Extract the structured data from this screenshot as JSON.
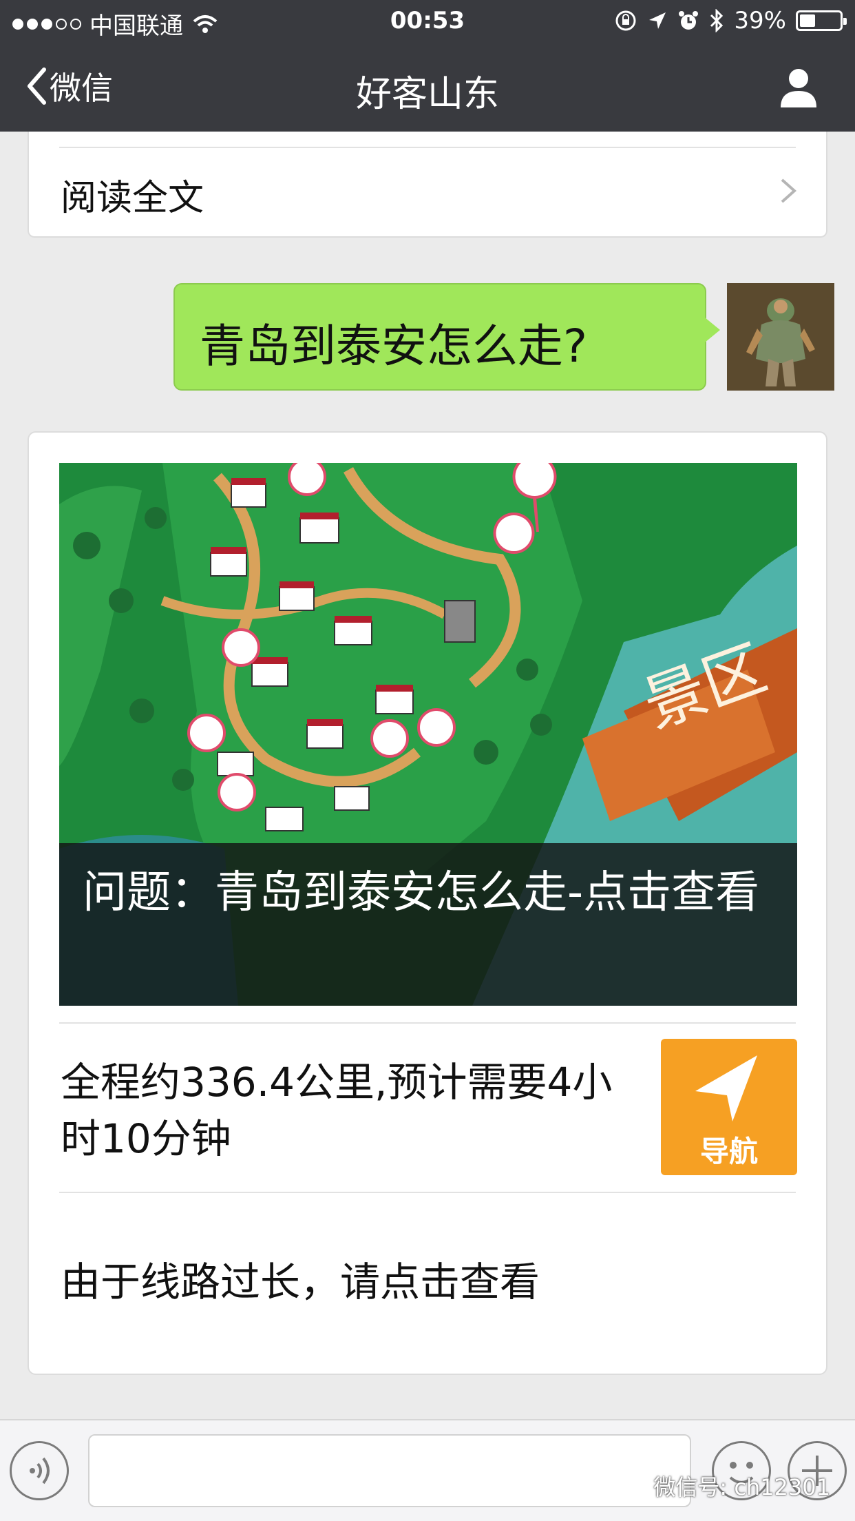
{
  "status_bar": {
    "carrier": "中国联通",
    "time": "00:53",
    "battery_percent": "39%",
    "battery_level": 0.39,
    "signal_bars_filled": 3,
    "signal_bars_total": 5
  },
  "nav": {
    "back_label": "微信",
    "title": "好客山东"
  },
  "read_card": {
    "label": "阅读全文"
  },
  "sent_message": {
    "text": "青岛到泰安怎么走?"
  },
  "route_card": {
    "map_sign": "景区",
    "caption": "问题：青岛到泰安怎么走-点击查看",
    "route_summary": "全程约336.4公里,预计需要4小时10分钟",
    "nav_button_label": "导航",
    "note": "由于线路过长，请点击查看"
  },
  "watermark": {
    "text": "微信号: ch12301"
  },
  "colors": {
    "nav_bg": "#393a3f",
    "bubble_green": "#a0e75a",
    "nav_button_orange": "#f6a023",
    "page_bg": "#ebebeb"
  }
}
